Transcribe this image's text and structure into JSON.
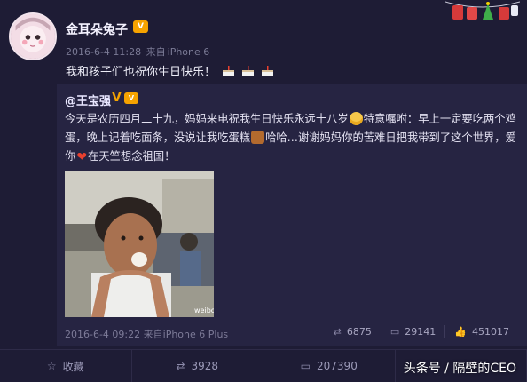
{
  "post": {
    "username": "金耳朵兔子",
    "vip_badge": "V",
    "timestamp": "2016-6-4 11:28",
    "source_prefix": "来自",
    "source": "iPhone 6",
    "text": "我和孩子们也祝你生日快乐！"
  },
  "quoted": {
    "username": "@王宝强",
    "verified_mark": "V",
    "vip_badge": "V",
    "text_part1": "今天是农历四月二十九，妈妈来电祝我生日快乐永远十八岁",
    "text_part2": "特意嘱咐：早上一定要吃两个鸡蛋，晚上记着吃面条，没说让我吃蛋糕",
    "text_part3": "哈哈…谢谢妈妈你的苦难日把我带到了这个世界，爱你",
    "text_part4": "在天竺想念祖国！",
    "timestamp": "2016-6-4 09:22",
    "source_prefix": "来自",
    "source": "iPhone 6 Plus",
    "reposts": "6875",
    "comments": "29141",
    "likes": "451017",
    "photo_watermark": "weibo"
  },
  "actions": {
    "favorite": "收藏",
    "repost": "3928",
    "comment": "207390"
  },
  "watermark": "头条号 / 隔壁的CEO",
  "icons": {
    "repost": "repost-icon",
    "comment": "comment-icon",
    "like": "thumbs-up-icon",
    "favorite": "star-icon"
  },
  "colors": {
    "background": "#1e1c35",
    "quote_background": "#262442",
    "vip": "#f6a300",
    "heart": "#e8402e"
  }
}
